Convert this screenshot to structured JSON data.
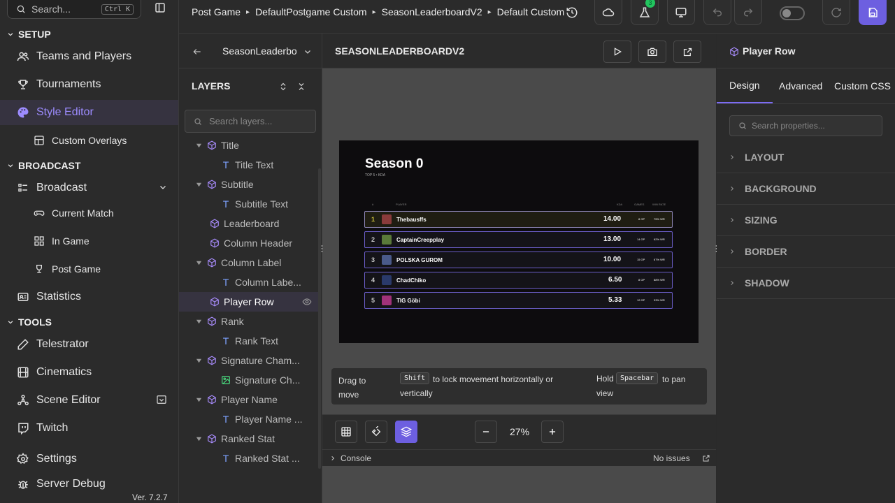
{
  "search": {
    "placeholder": "Search...",
    "shortcut": "Ctrl K"
  },
  "sidebar": {
    "sections": [
      {
        "title": "SETUP"
      },
      {
        "title": "BROADCAST"
      },
      {
        "title": "TOOLS"
      }
    ],
    "items": {
      "teams": "Teams and Players",
      "tournaments": "Tournaments",
      "style_editor": "Style Editor",
      "custom_overlays": "Custom Overlays",
      "broadcast": "Broadcast",
      "current_match": "Current Match",
      "in_game": "In Game",
      "post_game": "Post Game",
      "statistics": "Statistics",
      "telestrator": "Telestrator",
      "cinematics": "Cinematics",
      "scene_editor": "Scene Editor",
      "twitch": "Twitch",
      "settings": "Settings",
      "server_debug": "Server Debug"
    },
    "version": "Ver. 7.2.7"
  },
  "topbar": {
    "breadcrumb": [
      "Post Game",
      "DefaultPostgame Custom",
      "SeasonLeaderboardV2",
      "Default Custom"
    ],
    "badge_count": "3"
  },
  "layers": {
    "title": "LAYERS",
    "dropdown_value": "SeasonLeaderbo",
    "search_placeholder": "Search layers...",
    "items": [
      {
        "label": "Title"
      },
      {
        "label": "Title Text"
      },
      {
        "label": "Subtitle"
      },
      {
        "label": "Subtitle Text"
      },
      {
        "label": "Leaderboard"
      },
      {
        "label": "Column Header"
      },
      {
        "label": "Column Label"
      },
      {
        "label": "Column Labe..."
      },
      {
        "label": "Player Row"
      },
      {
        "label": "Rank"
      },
      {
        "label": "Rank Text"
      },
      {
        "label": "Signature Cham..."
      },
      {
        "label": "Signature Ch..."
      },
      {
        "label": "Player Name"
      },
      {
        "label": "Player Name ..."
      },
      {
        "label": "Ranked Stat"
      },
      {
        "label": "Ranked Stat ..."
      }
    ]
  },
  "canvas": {
    "title": "SEASONLEADERBOARDV2",
    "zoom": "27%",
    "hints": {
      "drag": "Drag to move",
      "shift_key": "Shift",
      "shift_text": "to lock movement horizontally or vertically",
      "hold": "Hold",
      "space_key": "Spacebar",
      "space_text": "to pan view"
    },
    "console_label": "Console",
    "console_status": "No issues"
  },
  "leaderboard": {
    "title": "Season 0",
    "subtitle": "TOP 5 • KDA",
    "headers": {
      "rank": "#",
      "player": "PLAYER",
      "kda": "KDA",
      "games": "GAMES",
      "winrate": "WIN RATE"
    },
    "rows": [
      {
        "rank": "1",
        "name": "Thebausffs",
        "kda": "14.00",
        "games": "8 GP",
        "winrate": "75% WR",
        "color": "#d0c33a"
      },
      {
        "rank": "2",
        "name": "CaptainCreepplay",
        "kda": "13.00",
        "games": "14 GP",
        "winrate": "62% WR",
        "color": "#c9c9c9"
      },
      {
        "rank": "3",
        "name": "POLSKA GUROM",
        "kda": "10.00",
        "games": "15 GP",
        "winrate": "67% WR",
        "color": "#c9c9c9"
      },
      {
        "rank": "4",
        "name": "ChadChiko",
        "kda": "6.50",
        "games": "8 GP",
        "winrate": "88% WR",
        "color": "#c9c9c9"
      },
      {
        "rank": "5",
        "name": "TIG Göbi",
        "kda": "5.33",
        "games": "12 GP",
        "winrate": "33% WR",
        "color": "#c9c9c9"
      }
    ]
  },
  "right_panel": {
    "title": "Player Row",
    "tabs": [
      "Design",
      "Advanced",
      "Custom CSS"
    ],
    "search_placeholder": "Search properties...",
    "sections": [
      "LAYOUT",
      "BACKGROUND",
      "SIZING",
      "BORDER",
      "SHADOW"
    ]
  },
  "colors": {
    "accent": "#7c6cf2",
    "active_bg": "#363340",
    "active_text": "#9d8cff"
  }
}
